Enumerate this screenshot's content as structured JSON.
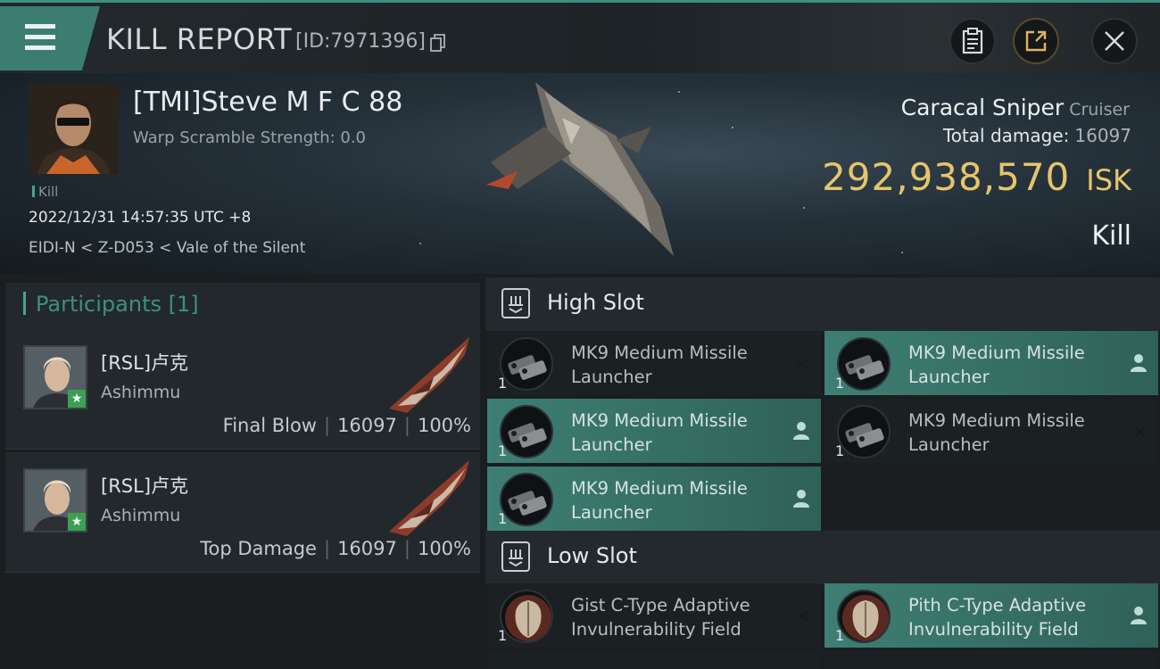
{
  "header": {
    "title": "KILL REPORT",
    "report_id": "[ID:7971396]"
  },
  "victim": {
    "name": "[TMI]Steve M F C 88",
    "warp_scramble": "Warp Scramble Strength: 0.0",
    "kill_tag": "Kill",
    "datetime": "2022/12/31 14:57:35 UTC +8",
    "location": "EIDI-N < Z-D053 < Vale of the Silent",
    "ship_name": "Caracal Sniper",
    "ship_class": "Cruiser",
    "total_damage_label": "Total damage:",
    "total_damage": "16097",
    "isk_value": "292,938,570",
    "isk_unit": "ISK",
    "result": "Kill"
  },
  "participants": {
    "title": "Participants [1]",
    "items": [
      {
        "name": "[RSL]卢克",
        "ship": "Ashimmu",
        "role": "Final Blow",
        "damage": "16097",
        "percent": "100%",
        "star": "★"
      },
      {
        "name": "[RSL]卢克",
        "ship": "Ashimmu",
        "role": "Top Damage",
        "damage": "16097",
        "percent": "100%",
        "star": "★"
      }
    ]
  },
  "fitting": {
    "high_slot": {
      "title": "High Slot",
      "modules": [
        {
          "name_1": "MK9 Medium Missile",
          "name_2": "Launcher",
          "qty": "1",
          "status": "destroyed",
          "status_icon": "✕",
          "icon": "missile-launcher-icon"
        },
        {
          "name_1": "MK9 Medium Missile",
          "name_2": "Launcher",
          "qty": "1",
          "status": "dropped",
          "status_icon": "person-icon",
          "icon": "missile-launcher-icon"
        },
        {
          "name_1": "MK9 Medium Missile",
          "name_2": "Launcher",
          "qty": "1",
          "status": "dropped",
          "status_icon": "person-icon",
          "icon": "missile-launcher-icon"
        },
        {
          "name_1": "MK9 Medium Missile",
          "name_2": "Launcher",
          "qty": "1",
          "status": "destroyed",
          "status_icon": "✕",
          "icon": "missile-launcher-icon"
        },
        {
          "name_1": "MK9 Medium Missile",
          "name_2": "Launcher",
          "qty": "1",
          "status": "dropped",
          "status_icon": "person-icon",
          "icon": "missile-launcher-icon"
        }
      ]
    },
    "low_slot": {
      "title": "Low Slot",
      "modules": [
        {
          "name_1": "Gist C-Type Adaptive",
          "name_2": "Invulnerability Field",
          "qty": "1",
          "status": "destroyed",
          "status_icon": "✕",
          "icon": "shield-module-icon"
        },
        {
          "name_1": "Pith C-Type Adaptive",
          "name_2": "Invulnerability Field",
          "qty": "1",
          "status": "dropped",
          "status_icon": "person-icon",
          "icon": "shield-module-icon"
        }
      ]
    }
  },
  "colors": {
    "accent": "#3f8f80",
    "isk": "#e6c56b",
    "dropped_bg": "#3e7f73"
  }
}
